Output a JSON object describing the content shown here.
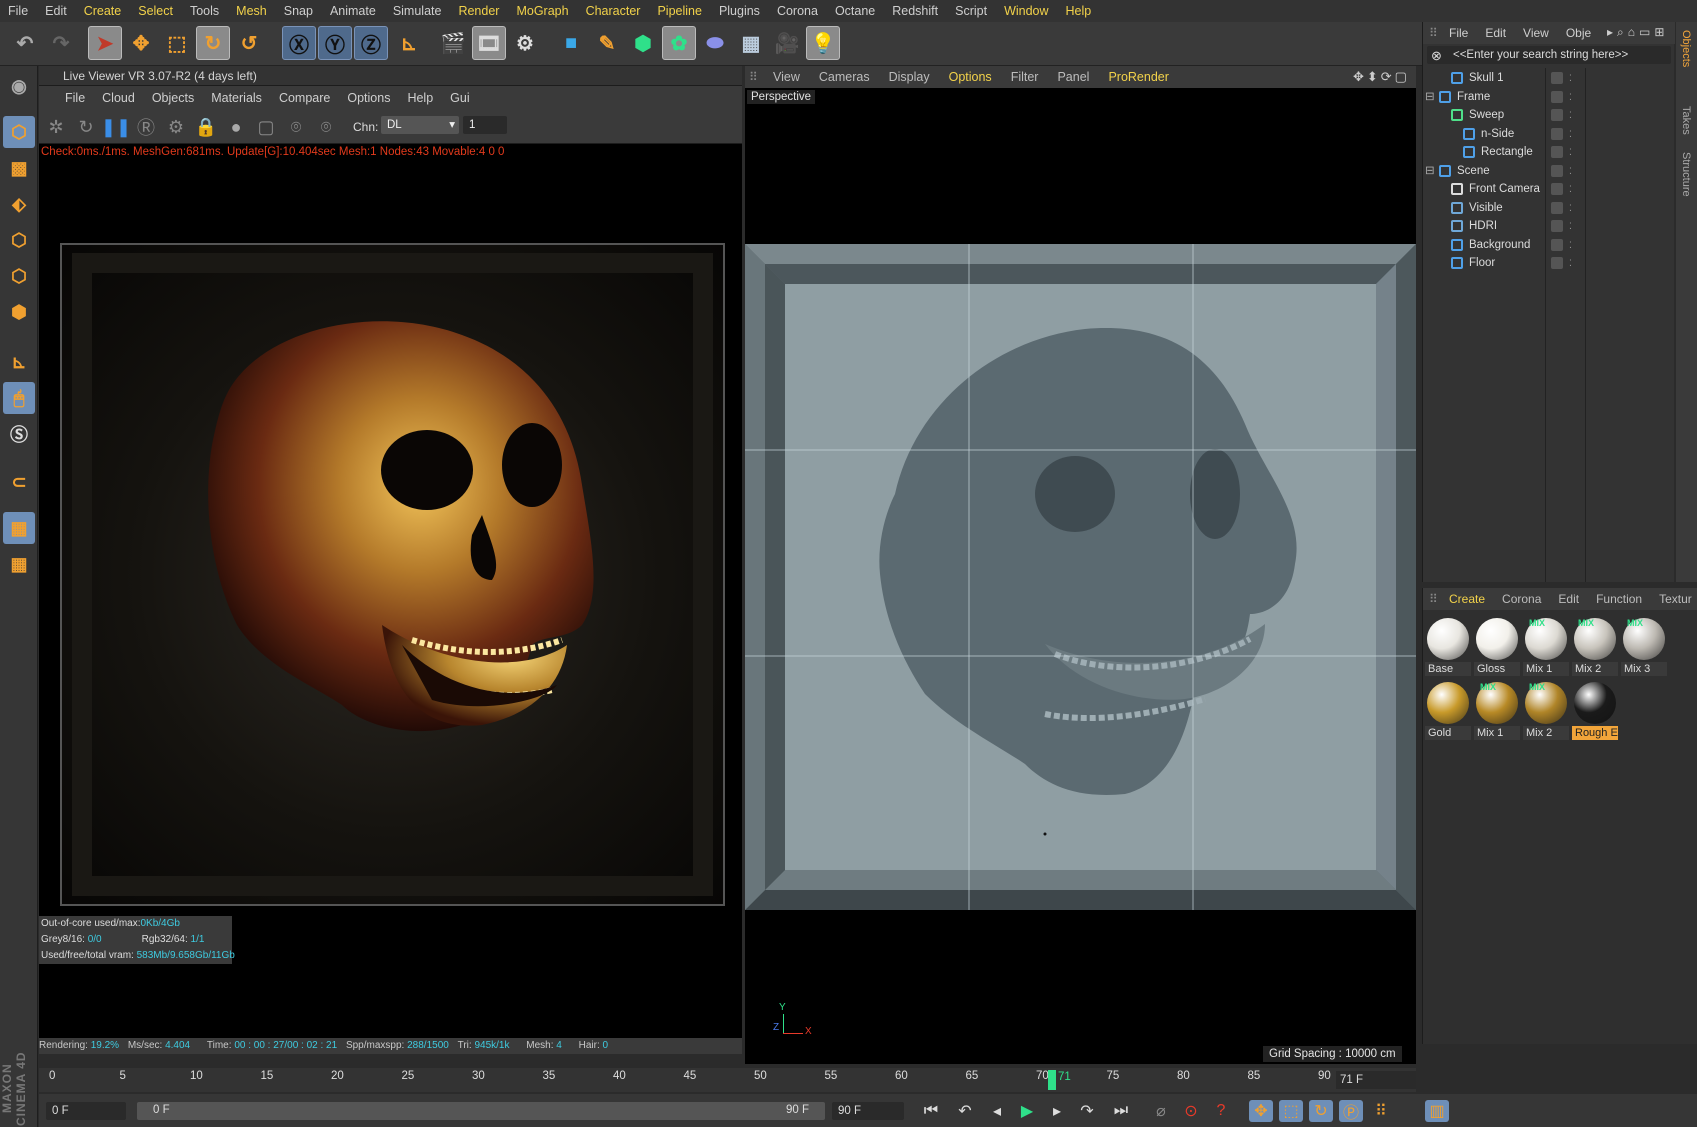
{
  "menubar": [
    "File",
    "Edit",
    "Create",
    "Select",
    "Tools",
    "Mesh",
    "Snap",
    "Animate",
    "Simulate",
    "Render",
    "MoGraph",
    "Character",
    "Pipeline",
    "Plugins",
    "Corona",
    "Octane",
    "Redshift",
    "Script",
    "Window",
    "Help"
  ],
  "menubar_highlighted": [
    "Create",
    "Select",
    "Mesh",
    "Render",
    "MoGraph",
    "Character",
    "Pipeline",
    "Window",
    "Help"
  ],
  "live_viewer": {
    "title": "Live Viewer VR 3.07-R2 (4 days left)",
    "menu": [
      "File",
      "Cloud",
      "Objects",
      "Materials",
      "Compare",
      "Options",
      "Help",
      "Gui"
    ],
    "channel_label": "Chn:",
    "channel_value": "DL",
    "channel_number": "1",
    "status_line": "Check:0ms./1ms. MeshGen:681ms. Update[G]:10.404sec Mesh:1 Nodes:43 Movable:4  0 0",
    "stats": {
      "out_of_core_label": "Out-of-core used/max:",
      "out_of_core_value": "0Kb/4Gb",
      "grey_label": "Grey8/16:",
      "grey_value": "0/0",
      "rgb_label": "Rgb32/64:",
      "rgb_value": "1/1",
      "vram_label": "Used/free/total vram:",
      "vram_value": "583Mb/9.658Gb/11Gb"
    },
    "bottom": {
      "rendering_label": "Rendering:",
      "rendering_value": "19.2%",
      "ms_label": "Ms/sec:",
      "ms_value": "4.404",
      "time_label": "Time:",
      "time_value": "00 : 00 : 27/00 : 02 : 21",
      "spp_label": "Spp/maxspp:",
      "spp_value": "288/1500",
      "tri_label": "Tri:",
      "tri_value": "945k/1k",
      "mesh_label": "Mesh:",
      "mesh_value": "4",
      "hair_label": "Hair:",
      "hair_value": "0"
    }
  },
  "viewport": {
    "menu": [
      "View",
      "Cameras",
      "Display",
      "Options",
      "Filter",
      "Panel",
      "ProRender"
    ],
    "menu_highlighted": [
      "Options",
      "ProRender"
    ],
    "label": "Perspective",
    "grid_spacing": "Grid Spacing : 10000 cm",
    "axis_y": "Y",
    "axis_z": "Z",
    "axis_x": "X"
  },
  "object_manager": {
    "menu": [
      "File",
      "Edit",
      "View",
      "Obje"
    ],
    "search_placeholder": "<<Enter your search string here>>",
    "items": [
      {
        "name": "Skull 1",
        "indent": 1,
        "icon": "skull-mesh-icon",
        "color": "#4fa0e8"
      },
      {
        "name": "Frame",
        "indent": 0,
        "icon": "null-object-icon",
        "color": "#4fa0e8"
      },
      {
        "name": "Sweep",
        "indent": 1,
        "icon": "sweep-icon",
        "color": "#4fe08a"
      },
      {
        "name": "n-Side",
        "indent": 2,
        "icon": "nside-spline-icon",
        "color": "#4fa0e8"
      },
      {
        "name": "Rectangle",
        "indent": 2,
        "icon": "rectangle-spline-icon",
        "color": "#4fa0e8"
      },
      {
        "name": "Scene",
        "indent": 0,
        "icon": "null-object-icon",
        "color": "#4fa0e8"
      },
      {
        "name": "Front Camera",
        "indent": 1,
        "icon": "camera-icon",
        "color": "#dddddd"
      },
      {
        "name": "Visible",
        "indent": 1,
        "icon": "light-sphere-icon",
        "color": "#6fa8d8"
      },
      {
        "name": "HDRI",
        "indent": 1,
        "icon": "light-sphere-icon",
        "color": "#6fa8d8"
      },
      {
        "name": "Background",
        "indent": 1,
        "icon": "plane-icon",
        "color": "#4fa0e8"
      },
      {
        "name": "Floor",
        "indent": 1,
        "icon": "plane-icon",
        "color": "#4fa0e8"
      }
    ],
    "side_tabs": [
      "Objects",
      "Takes",
      "Structure"
    ]
  },
  "material_manager": {
    "menu": [
      "Create",
      "Corona",
      "Edit",
      "Function",
      "Textur"
    ],
    "materials": [
      {
        "name": "Base",
        "ball": "#e8e6e0",
        "mix": ""
      },
      {
        "name": "Gloss",
        "ball": "#f2f0ea",
        "mix": ""
      },
      {
        "name": "Mix 1",
        "ball": "#dcd9d2",
        "mix": "MIX"
      },
      {
        "name": "Mix 2",
        "ball": "#c8c4bc",
        "mix": "MIX"
      },
      {
        "name": "Mix 3",
        "ball": "#bdb9b2",
        "mix": "MIX"
      },
      {
        "name": "Gold",
        "ball": "#c89a2a",
        "mix": ""
      },
      {
        "name": "Mix 1",
        "ball": "#b88a26",
        "mix": "MIX"
      },
      {
        "name": "Mix 2",
        "ball": "#b08528",
        "mix": "MIX"
      },
      {
        "name": "Rough E",
        "ball": "#1a1a1a",
        "mix": ""
      }
    ]
  },
  "timeline": {
    "ticks": [
      "0",
      "5",
      "10",
      "15",
      "20",
      "25",
      "30",
      "35",
      "40",
      "45",
      "50",
      "55",
      "60",
      "65",
      "70",
      "75",
      "80",
      "85",
      "90"
    ],
    "current_frame_marker": "71",
    "current_frame_field": "71 F",
    "start_field": "0 F",
    "range_start": "0 F",
    "range_end": "90 F",
    "end_field": "90 F"
  },
  "branding": "MAXON CINEMA 4D",
  "colors": {
    "accent_yellow": "#f2d24a",
    "status_red": "#e23a1c",
    "stat_cyan": "#3ecbe0",
    "active_blue": "#6e8fb8"
  }
}
